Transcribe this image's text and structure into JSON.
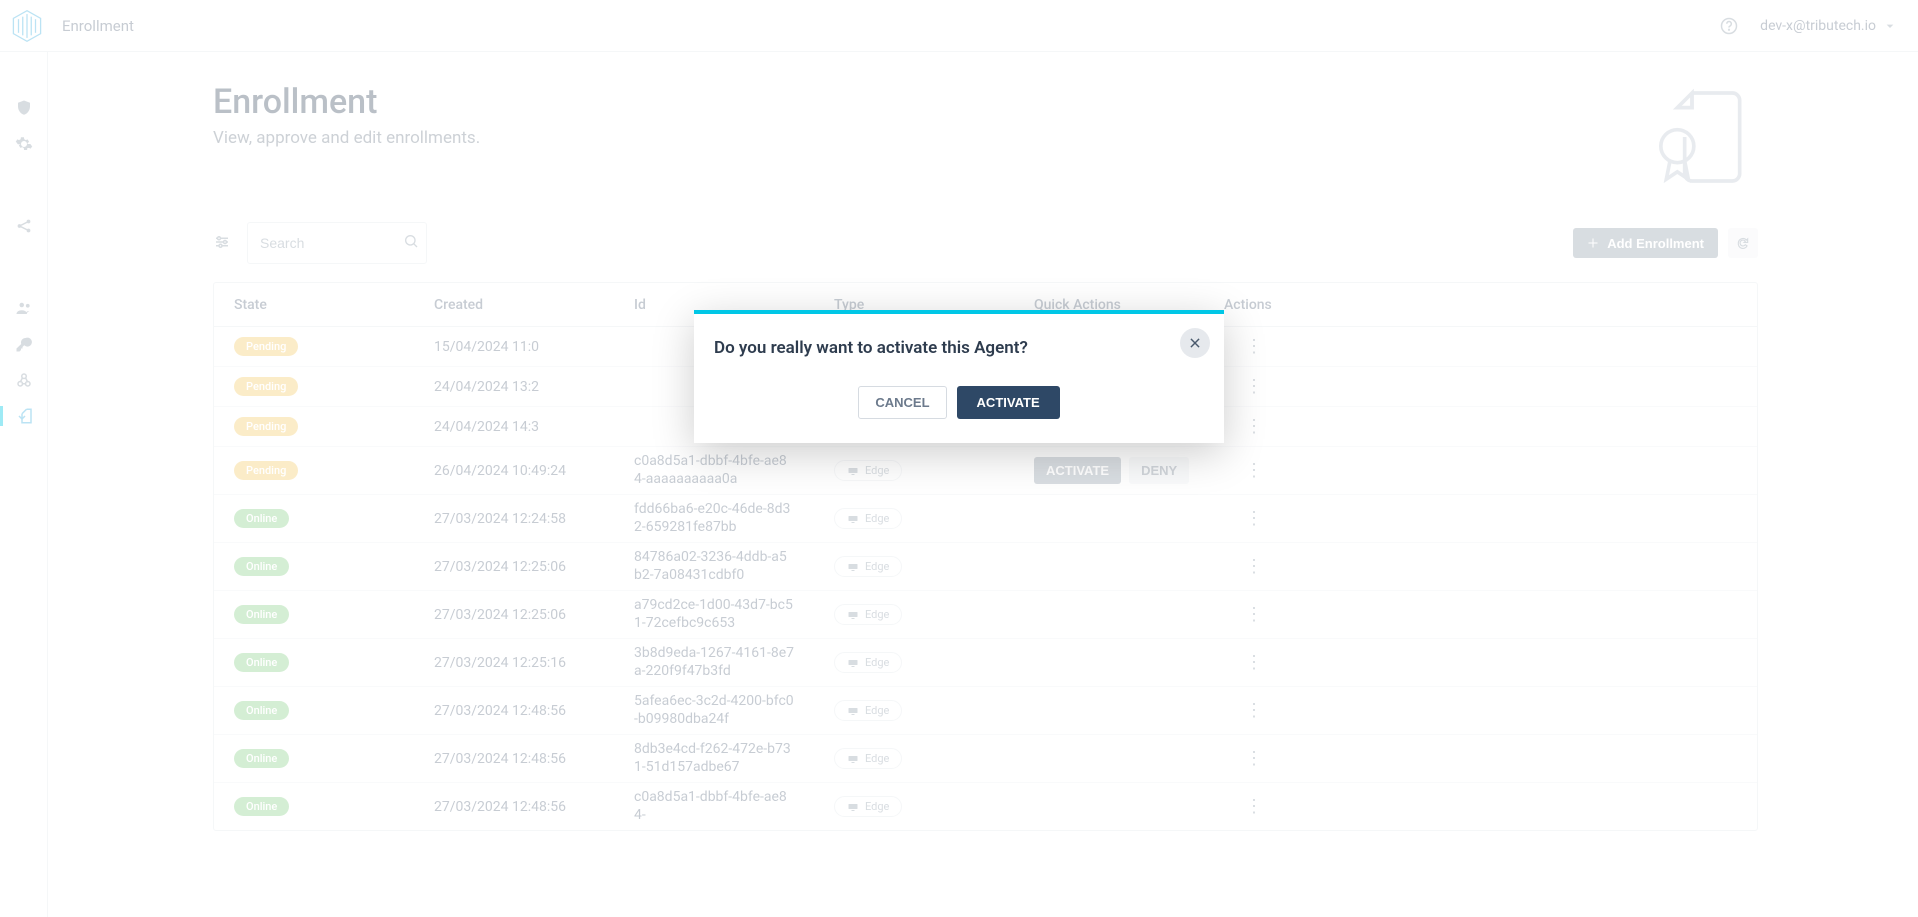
{
  "header": {
    "breadcrumb": "Enrollment",
    "user_email": "dev-x@tributech.io"
  },
  "page": {
    "title": "Enrollment",
    "subtitle": "View, approve and edit enrollments."
  },
  "toolbar": {
    "search_placeholder": "Search",
    "add_button": "Add Enrollment"
  },
  "table": {
    "columns": {
      "state": "State",
      "created": "Created",
      "id": "Id",
      "type": "Type",
      "quick_actions": "Quick Actions",
      "actions": "Actions"
    },
    "badge_labels": {
      "pending": "Pending",
      "online": "Online"
    },
    "type_label": "Edge",
    "qa_labels": {
      "activate": "ACTIVATE",
      "deny": "DENY"
    },
    "rows": [
      {
        "state": "pending",
        "created": "15/04/2024 11:0",
        "id": "",
        "show_qa": true
      },
      {
        "state": "pending",
        "created": "24/04/2024 13:2",
        "id": "",
        "show_qa": true
      },
      {
        "state": "pending",
        "created": "24/04/2024 14:3",
        "id": "",
        "show_qa": true
      },
      {
        "state": "pending",
        "created": "26/04/2024 10:49:24",
        "id": "c0a8d5a1-dbbf-4bfe-ae84-aaaaaaaaaa0a",
        "show_qa": true
      },
      {
        "state": "online",
        "created": "27/03/2024 12:24:58",
        "id": "fdd66ba6-e20c-46de-8d32-659281fe87bb",
        "show_qa": false
      },
      {
        "state": "online",
        "created": "27/03/2024 12:25:06",
        "id": "84786a02-3236-4ddb-a5b2-7a08431cdbf0",
        "show_qa": false
      },
      {
        "state": "online",
        "created": "27/03/2024 12:25:06",
        "id": "a79cd2ce-1d00-43d7-bc51-72cefbc9c653",
        "show_qa": false
      },
      {
        "state": "online",
        "created": "27/03/2024 12:25:16",
        "id": "3b8d9eda-1267-4161-8e7a-220f9f47b3fd",
        "show_qa": false
      },
      {
        "state": "online",
        "created": "27/03/2024 12:48:56",
        "id": "5afea6ec-3c2d-4200-bfc0-b09980dba24f",
        "show_qa": false
      },
      {
        "state": "online",
        "created": "27/03/2024 12:48:56",
        "id": "8db3e4cd-f262-472e-b731-51d157adbe67",
        "show_qa": false
      },
      {
        "state": "online",
        "created": "27/03/2024 12:48:56",
        "id": "c0a8d5a1-dbbf-4bfe-ae84-",
        "show_qa": false
      }
    ]
  },
  "modal": {
    "title": "Do you really want to activate this Agent?",
    "cancel": "CANCEL",
    "confirm": "ACTIVATE"
  },
  "colors": {
    "accent": "#00c7e6",
    "primary_dark": "#2e4866"
  }
}
